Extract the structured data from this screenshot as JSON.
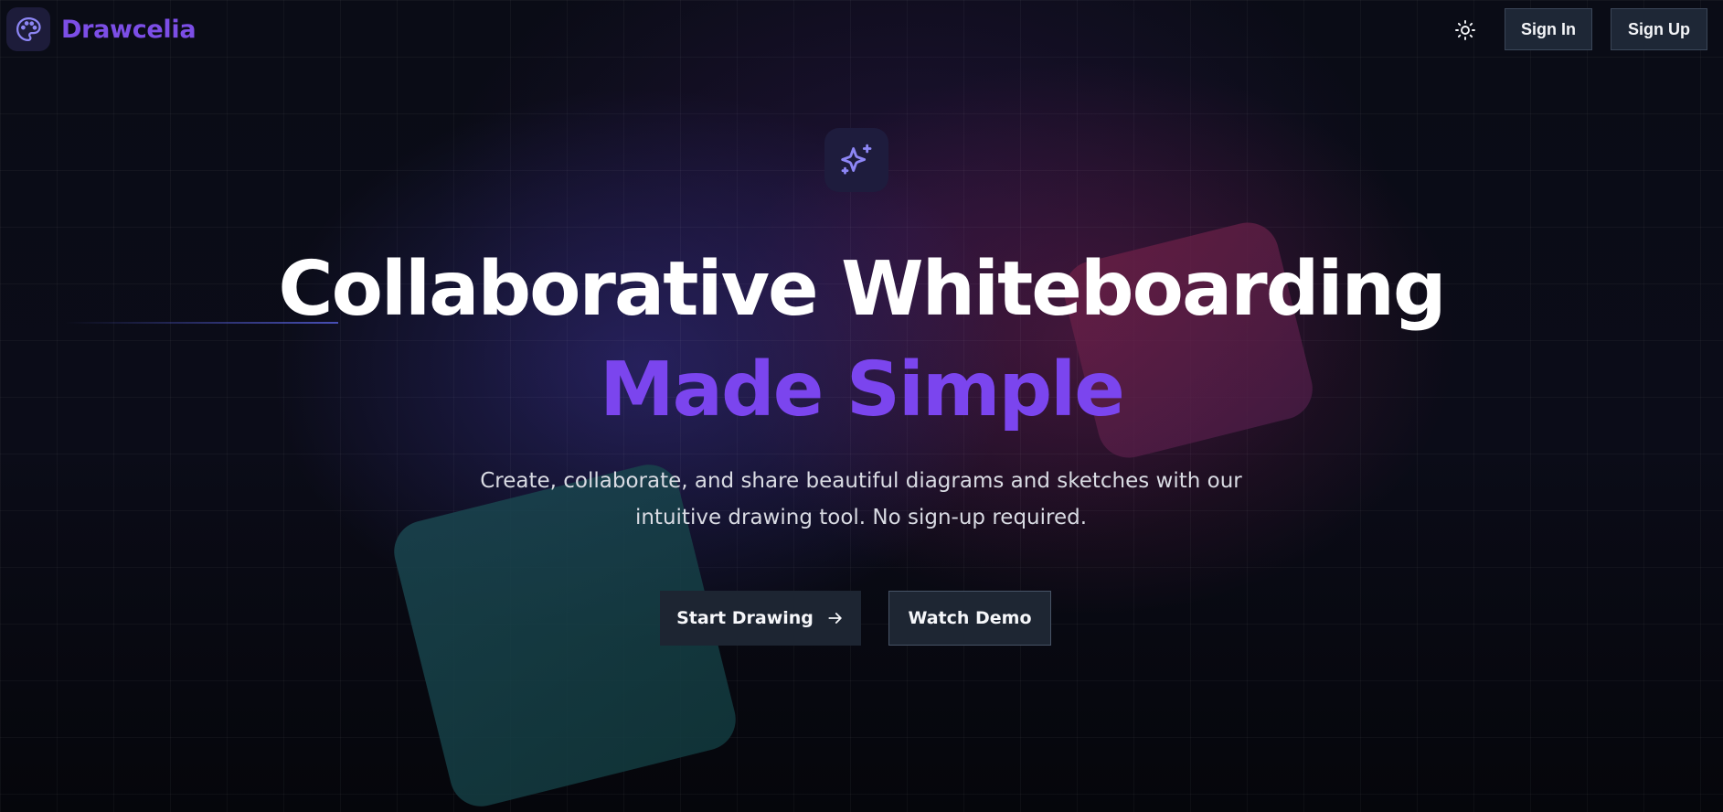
{
  "header": {
    "brand": "Drawcelia",
    "logo_icon": "palette-icon",
    "theme_icon": "sun-icon",
    "sign_in_label": "Sign In",
    "sign_up_label": "Sign Up"
  },
  "hero": {
    "badge_icon": "sparkles-icon",
    "title_line1": "Collaborative Whiteboarding",
    "title_line2": "Made Simple",
    "description_line1": "Create, collaborate, and share beautiful diagrams and sketches with our",
    "description_line2": "intuitive drawing tool. No sign-up required.",
    "primary_cta_label": "Start Drawing",
    "primary_cta_icon": "arrow-right-icon",
    "secondary_cta_label": "Watch Demo"
  },
  "colors": {
    "background": "#090b14",
    "brand": "#7c4ee6",
    "accent_title": "#7b45ee",
    "button_bg": "#1e2736",
    "button_border": "#3b4658",
    "icon_accent": "#8d86f5"
  }
}
